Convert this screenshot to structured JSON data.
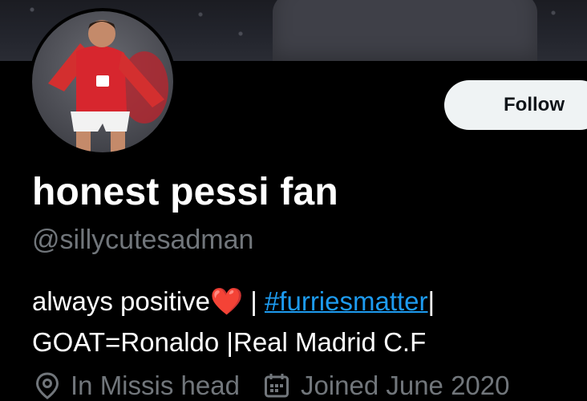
{
  "profile": {
    "display_name": "honest pessi fan",
    "handle": "@sillycutesadman",
    "follow_label": "Follow",
    "bio": {
      "text_start": "always positive",
      "heart": "❤️",
      "separator_1": " | ",
      "hashtag": "#furriesmatter",
      "separator_2": "|",
      "line_2": "GOAT=Ronaldo |Real Madrid C.F"
    },
    "location": "In Missis head",
    "joined": "Joined June 2020"
  },
  "icons": {
    "location": "location-pin-icon",
    "joined": "calendar-icon"
  },
  "colors": {
    "background": "#000000",
    "text_primary": "#ffffff",
    "text_secondary": "#71767b",
    "link": "#1d9bf0",
    "follow_button_bg": "#eff3f4",
    "follow_button_text": "#0f1419"
  }
}
